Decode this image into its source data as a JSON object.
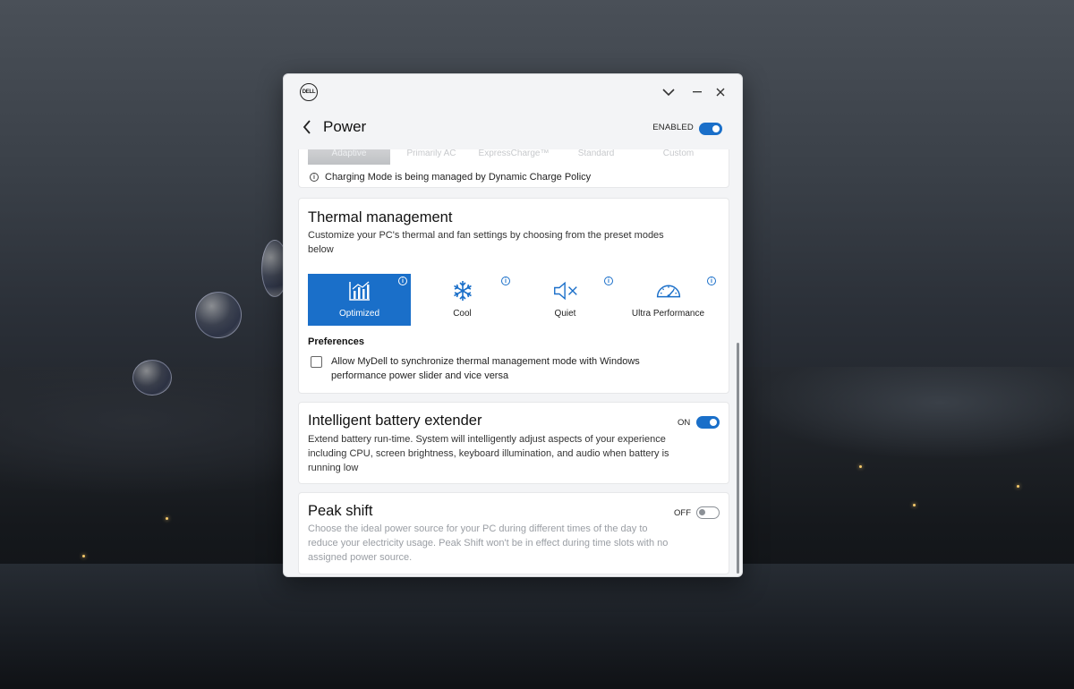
{
  "window": {
    "logo_text": "DELL",
    "title": "Power",
    "enabled_label": "ENABLED",
    "enabled": true
  },
  "charging": {
    "modes": [
      "Adaptive",
      "Primarily AC",
      "ExpressCharge™",
      "Standard",
      "Custom"
    ],
    "selected": "Adaptive",
    "note": "Charging Mode is being managed by Dynamic Charge Policy"
  },
  "thermal": {
    "title": "Thermal management",
    "description": "Customize your PC's thermal and fan settings by choosing from the preset modes below",
    "modes": [
      {
        "label": "Optimized",
        "icon": "optimized-chart-icon"
      },
      {
        "label": "Cool",
        "icon": "snowflake-icon"
      },
      {
        "label": "Quiet",
        "icon": "speaker-mute-icon"
      },
      {
        "label": "Ultra Performance",
        "icon": "speedometer-icon"
      }
    ],
    "selected": "Optimized",
    "preferences_heading": "Preferences",
    "sync_option": "Allow MyDell to synchronize thermal management mode with Windows performance power slider and vice versa",
    "sync_checked": false
  },
  "battery_extender": {
    "title": "Intelligent battery extender",
    "description": "Extend battery run-time. System will intelligently adjust aspects of your experience including CPU, screen brightness, keyboard illumination, and audio when battery is running low",
    "state_label": "ON",
    "on": true
  },
  "peak_shift": {
    "title": "Peak shift",
    "description": "Choose the ideal power source for your PC during different times of the day to reduce your electricity usage. Peak Shift won't be in effect during time slots with no assigned power source.",
    "state_label": "OFF",
    "on": false
  },
  "colors": {
    "accent": "#1a6fc9",
    "window_bg": "#f3f4f6",
    "card_bg": "#ffffff"
  }
}
